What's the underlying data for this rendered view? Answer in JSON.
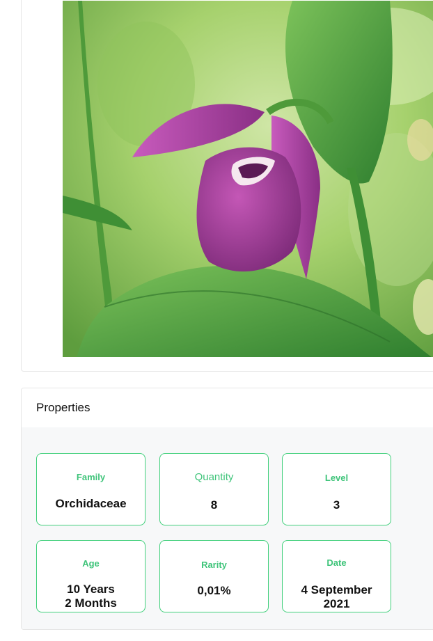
{
  "photo": {
    "subject": "pink-lady-slipper-orchid-photo",
    "colors": {
      "background": "#9fcc66",
      "petal": "#a63aa0",
      "leaf": "#3f9d3b"
    }
  },
  "properties": {
    "title": "Properties",
    "accent_color": "#3fcf7a",
    "items": [
      {
        "label": "Family",
        "value": "Orchidaceae"
      },
      {
        "label": "Quantity",
        "value": "8"
      },
      {
        "label": "Level",
        "value": "3"
      },
      {
        "label": "Age",
        "value": "10 Years\n2 Months"
      },
      {
        "label": "Rarity",
        "value": "0,01%"
      },
      {
        "label": "Date",
        "value": "4 September\n2021"
      }
    ]
  }
}
